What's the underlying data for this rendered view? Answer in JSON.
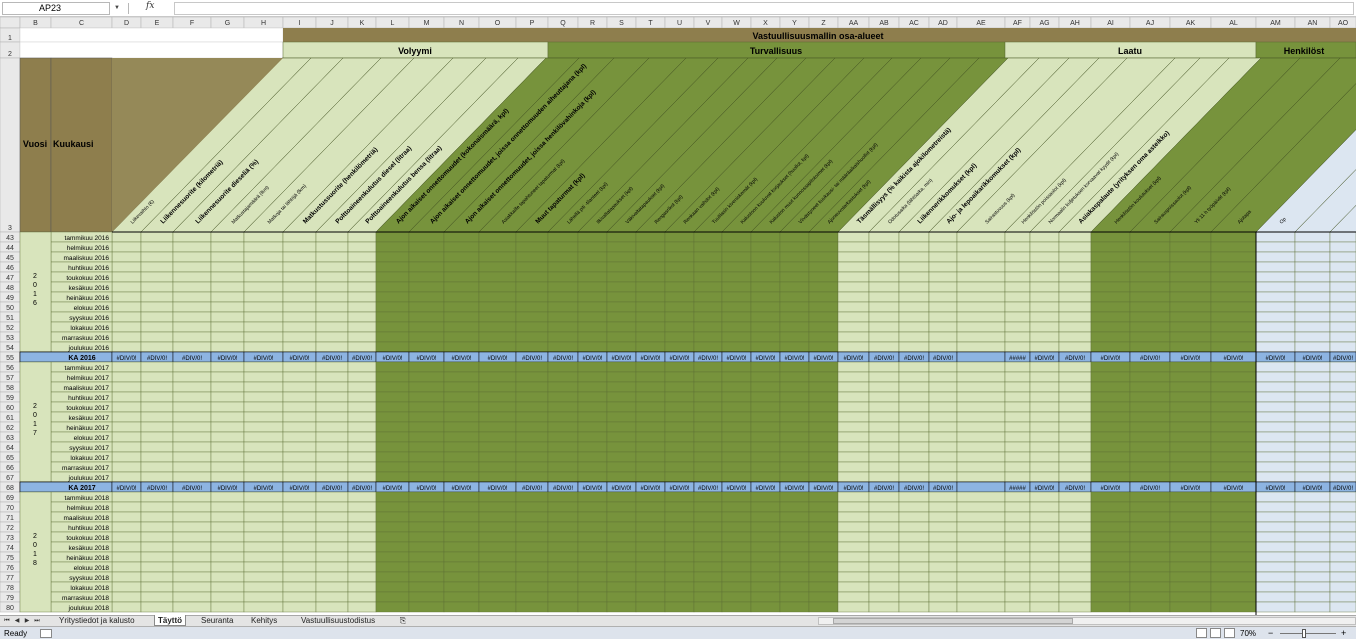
{
  "formula_bar": {
    "name_box": "AP23",
    "fx_icon": "fx",
    "formula": ""
  },
  "column_headers": [
    "B",
    "C",
    "D",
    "E",
    "F",
    "G",
    "H",
    "I",
    "J",
    "K",
    "L",
    "M",
    "N",
    "O",
    "P",
    "Q",
    "R",
    "S",
    "T",
    "U",
    "V",
    "W",
    "X",
    "Y",
    "Z",
    "AA",
    "AB",
    "AC",
    "AD",
    "AE",
    "AF",
    "AG",
    "AH",
    "AI",
    "AJ",
    "AK",
    "AL",
    "AM",
    "AN",
    "AO"
  ],
  "header_rows": [
    "1",
    "2",
    "3"
  ],
  "main_title": "Vastuullisuusmallin osa-alueet",
  "sections": [
    "Volyymi",
    "Turvallisuus",
    "Laatu",
    "Henkilöst"
  ],
  "left_headers": {
    "vuosi": "Vuosi",
    "kuukausi": "Kuukausi"
  },
  "metrics": [
    "Liikevaihto (€)",
    "Liikennesuorite (kilometriä)",
    "Liikennesuorite dieseliä (%)",
    "Matkustajamäärä (lkm)",
    "Matkoja tai lähtöjä (lkm)",
    "Matkustussuorite (henkilömetriä)",
    "Polttoaineenkulutus diesel (litraa)",
    "Polttoaineenkulutus bensa (litraa)",
    "Ajon aikaiset onnettomuudet (kokonaismäärä, kpl)",
    "Ajon aikaiset onnettomuudet, joissa onnettomuuden aiheuttajana (kpl)",
    "Ajon aikaiset onnettomuudet, joissa henkilövahinkoja (kpl)",
    "Asiakkaille tapahtuneet tapaturmat (kpl)",
    "Muut tapaturmat (kpl)",
    "Lähellä piti -tilanteet (kpl)",
    "Ilkivaltatapaukset (kpl)",
    "Väkivaltatapaukset (kpl)",
    "Rengasrikot (kpl)",
    "Renkaan vaihdot (kpl)",
    "Tuulilasin kiveniskemät (kpl)",
    "Kalustoon kuuluvat korjaukset (huollot, kpl)",
    "Kaluston muut kunnossapitotoimet (kpl)",
    "Viivästyneet kuukausi- tai määräaikaishuollot (kpl)",
    "Ajoneuvotarkastukset (kpl)",
    "Täsmällisyys (% kaikista ajokilometreistä)",
    "Odotusaika (lähtöaika, min)",
    "Liikennerikkomukset (kpl)",
    "Ajo- ja lepoaikarikkomukset (kpl)",
    "Sairastuvuus (kpl)",
    "Henkilöstön poissaolot (kpl)",
    "Normaalin kuljetuksen korvaavat kyydit (kpl)",
    "Asiakaspalaute (yrityksen oma asteikko)",
    "Henkilöstön koulutukset (kpl)",
    "Sairauspoissaolot (kpl)",
    "Yli 11 h työpäivät (kpl)",
    "Ajotapa",
    "Op"
  ],
  "years": [
    {
      "year_label": [
        "2",
        "0",
        "1",
        "6"
      ],
      "row_start": 43,
      "total_row": 55,
      "total_label": "KA 2016",
      "months": [
        "tammikuu 2016",
        "helmikuu 2016",
        "maaliskuu 2016",
        "huhtikuu 2016",
        "toukokuu 2016",
        "kesäkuu 2016",
        "heinäkuu 2016",
        "elokuu 2016",
        "syyskuu 2016",
        "lokakuu 2016",
        "marraskuu 2016",
        "joulukuu 2016"
      ]
    },
    {
      "year_label": [
        "2",
        "0",
        "1",
        "7"
      ],
      "row_start": 56,
      "total_row": 68,
      "total_label": "KA 2017",
      "months": [
        "tammikuu 2017",
        "helmikuu 2017",
        "maaliskuu 2017",
        "huhtikuu 2017",
        "toukokuu 2017",
        "kesäkuu 2017",
        "heinäkuu 2017",
        "elokuu 2017",
        "syyskuu 2017",
        "lokakuu 2017",
        "marraskuu 2017",
        "joulukuu 2017"
      ]
    },
    {
      "year_label": [
        "2",
        "0",
        "1",
        "8"
      ],
      "row_start": 69,
      "total_row": null,
      "total_label": "",
      "months": [
        "tammikuu 2018",
        "helmikuu 2018",
        "maaliskuu 2018",
        "huhtikuu 2018",
        "toukokuu 2018",
        "kesäkuu 2018",
        "heinäkuu 2018",
        "elokuu 2018",
        "syyskuu 2018",
        "lokakuu 2018",
        "marraskuu 2018",
        "joulukuu 2018"
      ]
    }
  ],
  "error_value": "#DIV/0!",
  "overflow_value": "#####",
  "sheet_tabs": [
    "Yritystiedot ja kalusto",
    "Täyttö",
    "Seuranta",
    "Kehitys",
    "Vastuullisuustodistus"
  ],
  "active_tab": "Täyttö",
  "status": {
    "ready": "Ready",
    "zoom": "70%",
    "minus": "−",
    "plus": "+"
  },
  "colors": {
    "olive": "#8e7e4d",
    "light_green": "#d8e4bc",
    "dark_green": "#77933c",
    "light_blue": "#dce6f1",
    "total_blue": "#8db4e2",
    "header_gray": "#e9e9e9"
  }
}
